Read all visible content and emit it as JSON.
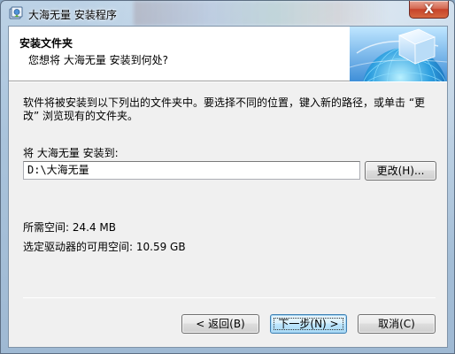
{
  "window": {
    "title": "大海无量 安装程序",
    "close_label": "X"
  },
  "header": {
    "title": "安装文件夹",
    "subtitle": "您想将 大海无量 安装到何处?"
  },
  "body": {
    "description": "软件将被安装到以下列出的文件夹中。要选择不同的位置，键入新的路径，或单击 “更改” 浏览现有的文件夹。",
    "install_label": "将 大海无量 安装到:",
    "install_path": "D:\\大海无量",
    "browse_label": "更改(H)...",
    "space_required": "所需空间: 24.4 MB",
    "space_available": "选定驱动器的可用空间: 10.59 GB"
  },
  "footer": {
    "back_label": "< 返回(B)",
    "next_label": "下一步(N) >",
    "cancel_label": "取消(C)"
  },
  "icons": {
    "app": "installer-icon",
    "header": "globe-cube-icon",
    "close": "close-icon"
  },
  "colors": {
    "client_bg": "#f0f0f0",
    "header_bg": "#ffffff",
    "default_button_border": "#3c7fb1",
    "close_button": "#c7432b"
  }
}
